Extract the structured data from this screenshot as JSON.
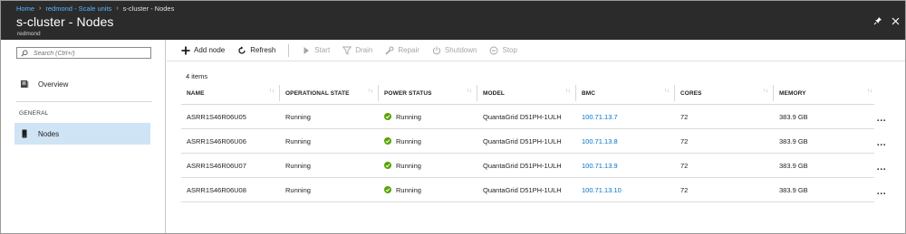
{
  "breadcrumb": [
    {
      "label": "Home",
      "link": true
    },
    {
      "label": "redmond - Scale units",
      "link": true
    },
    {
      "label": "s-cluster - Nodes",
      "link": false
    }
  ],
  "header": {
    "title": "s-cluster - Nodes",
    "subtitle": "redmond"
  },
  "search": {
    "placeholder": "Search (Ctrl+/)"
  },
  "sidebar": {
    "overview_label": "Overview",
    "group_label": "GENERAL",
    "nodes_label": "Nodes"
  },
  "toolbar": {
    "add_node": "Add node",
    "refresh": "Refresh",
    "start": "Start",
    "drain": "Drain",
    "repair": "Repair",
    "shutdown": "Shutdown",
    "stop": "Stop"
  },
  "table": {
    "count": "4 items",
    "columns": [
      "NAME",
      "OPERATIONAL STATE",
      "POWER STATUS",
      "MODEL",
      "BMC",
      "CORES",
      "MEMORY"
    ],
    "rows": [
      {
        "name": "ASRR1S46R06U05",
        "state": "Running",
        "power": "Running",
        "model": "QuantaGrid D51PH-1ULH",
        "bmc": "100.71.13.7",
        "cores": "72",
        "memory": "383.9 GB"
      },
      {
        "name": "ASRR1S46R06U06",
        "state": "Running",
        "power": "Running",
        "model": "QuantaGrid D51PH-1ULH",
        "bmc": "100.71.13.8",
        "cores": "72",
        "memory": "383.9 GB"
      },
      {
        "name": "ASRR1S46R06U07",
        "state": "Running",
        "power": "Running",
        "model": "QuantaGrid D51PH-1ULH",
        "bmc": "100.71.13.9",
        "cores": "72",
        "memory": "383.9 GB"
      },
      {
        "name": "ASRR1S46R06U08",
        "state": "Running",
        "power": "Running",
        "model": "QuantaGrid D51PH-1ULH",
        "bmc": "100.71.13.10",
        "cores": "72",
        "memory": "383.9 GB"
      }
    ]
  },
  "colors": {
    "header_bg": "#2b2b2b",
    "link": "#0072c6",
    "running": "#57a300",
    "selected_nav": "#cfe4f5"
  }
}
